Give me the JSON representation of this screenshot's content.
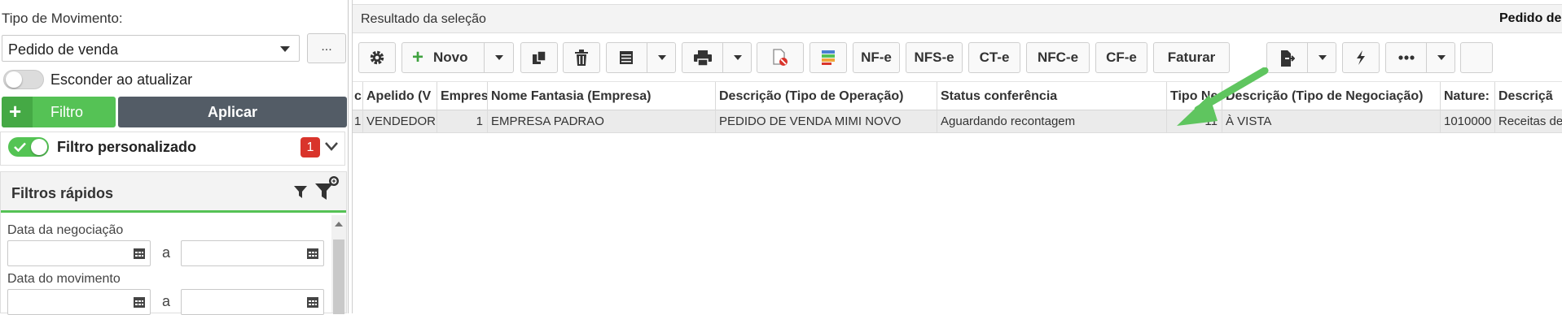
{
  "left_panel": {
    "movement_type_label": "Tipo de Movimento:",
    "movement_type_value": "Pedido de venda",
    "more_button_label": "...",
    "hide_on_update_label": "Esconder ao atualizar",
    "hide_on_update_on": false,
    "filter_button_label": "Filtro",
    "apply_button_label": "Aplicar",
    "custom_filter_label": "Filtro personalizado",
    "custom_filter_on": true,
    "custom_filter_count": "1",
    "quick_filters_title": "Filtros rápidos",
    "date_negotiation_label": "Data da negociação",
    "date_movement_label": "Data do movimento",
    "range_separator": "a"
  },
  "result_panel": {
    "title": "Resultado da seleção",
    "right_title": "Pedido de",
    "toolbar": {
      "new_label": "Novo",
      "nfe_label": "NF-e",
      "nfse_label": "NFS-e",
      "cte_label": "CT-e",
      "nfce_label": "NFC-e",
      "cfe_label": "CF-e",
      "invoice_label": "Faturar",
      "icons": [
        "gear-icon",
        "copy-icon",
        "trash-icon",
        "list-icon",
        "print-icon",
        "document-cancel-icon",
        "color-stack-icon",
        "export-icon",
        "bolt-icon",
        "more-icon"
      ]
    },
    "columns": [
      "c",
      "Apelido (V",
      "Empres",
      "Nome Fantasia (Empresa)",
      "Descrição (Tipo de Operação)",
      "Status conferência",
      "Tipo Ne",
      "Descrição (Tipo de Negociação)",
      "Nature:",
      "Descriçã"
    ],
    "rows": [
      [
        "1",
        "VENDEDOR",
        "1",
        "EMPRESA PADRAO",
        "PEDIDO DE VENDA MIMI NOVO",
        "Aguardando recontagem",
        "11",
        "À VISTA",
        "1010000",
        "Receitas de"
      ]
    ]
  },
  "colors": {
    "accent_green": "#55c255",
    "apply_dark": "#535c66",
    "badge_red": "#d9342b",
    "arrow_green": "#5fc55f"
  }
}
